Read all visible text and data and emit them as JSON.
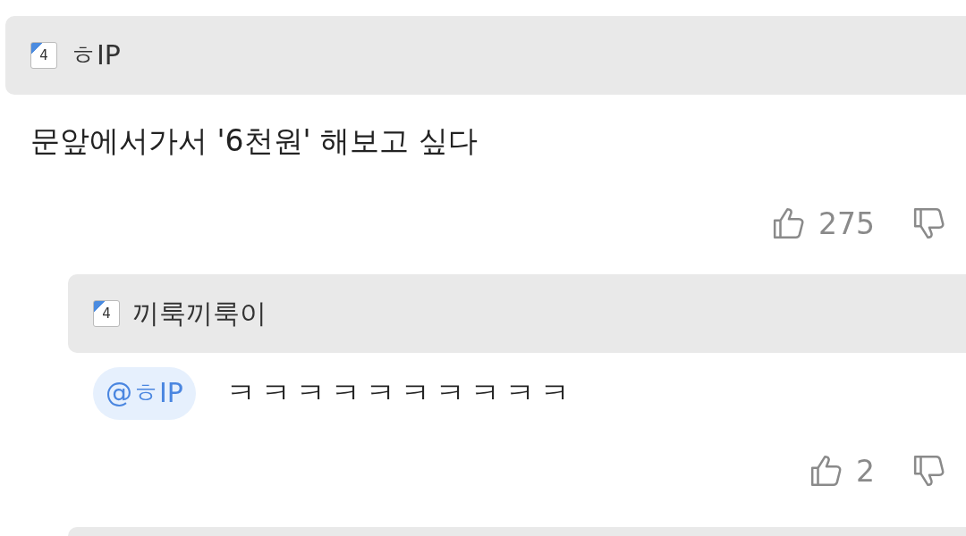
{
  "comments": [
    {
      "author": "ㅎIP",
      "level_badge": "4",
      "text": "문앞에서가서 '6천원' 해보고 싶다",
      "likes": "275",
      "replies": [
        {
          "author": "끼룩끼룩이",
          "level_badge": "4",
          "mention": "@ㅎIP",
          "text": "ㅋㅋㅋㅋㅋㅋㅋㅋㅋㅋ",
          "likes": "2"
        }
      ]
    }
  ]
}
